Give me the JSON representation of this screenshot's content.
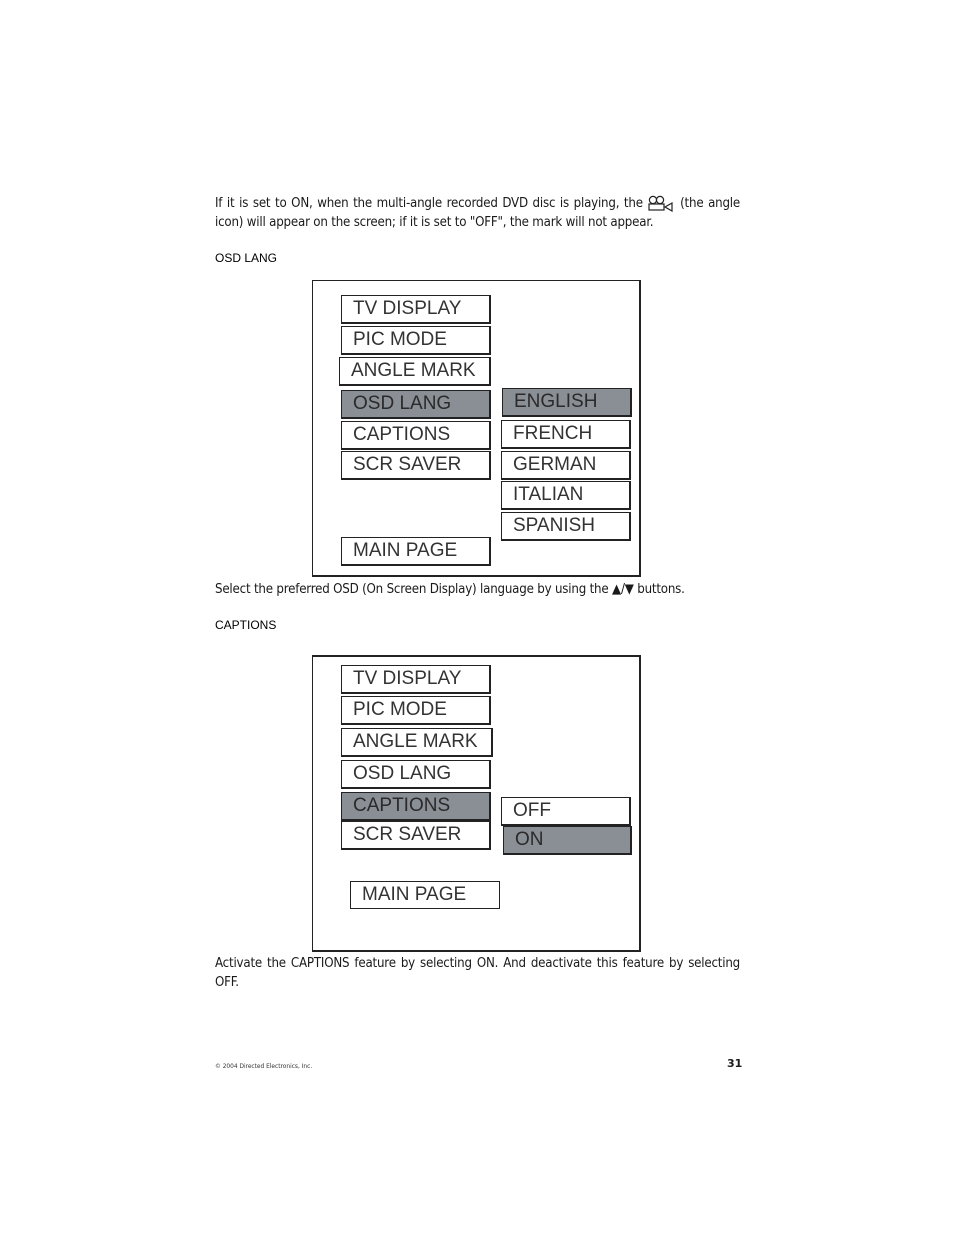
{
  "intro": {
    "text_before_icon": "If it is set to ON, when the multi-angle recorded DVD disc is playing, the",
    "icon": "angle-icon",
    "text_after_icon": "(the angle icon) will appear on the screen; if it is set to \"OFF\", the mark will not appear."
  },
  "osd_lang": {
    "heading": "OSD LANG",
    "menu_items": [
      "TV DISPLAY",
      "PIC MODE",
      "ANGLE MARK",
      "OSD LANG",
      "CAPTIONS",
      "SCR SAVER"
    ],
    "selected_item": "OSD LANG",
    "main_page": "MAIN PAGE",
    "options": [
      "ENGLISH",
      "FRENCH",
      "GERMAN",
      "ITALIAN",
      "SPANISH"
    ],
    "selected_option": "ENGLISH",
    "description": "Select the preferred OSD (On Screen Display) language by using the ▲/▼ buttons."
  },
  "captions": {
    "heading": "CAPTIONS",
    "menu_items": [
      "TV DISPLAY",
      "PIC MODE",
      "ANGLE MARK",
      "OSD LANG",
      "CAPTIONS",
      "SCR SAVER"
    ],
    "selected_item": "CAPTIONS",
    "main_page": "MAIN PAGE",
    "options": [
      "OFF",
      "ON"
    ],
    "selected_option": "ON",
    "description": "Activate the CAPTIONS feature by selecting ON. And deactivate this feature by selecting OFF."
  },
  "footer": {
    "copyright": "© 2004  Directed Electronics, Inc.",
    "page_number": "31"
  },
  "colors": {
    "highlight": "#8a8f96",
    "border": "#222222"
  }
}
